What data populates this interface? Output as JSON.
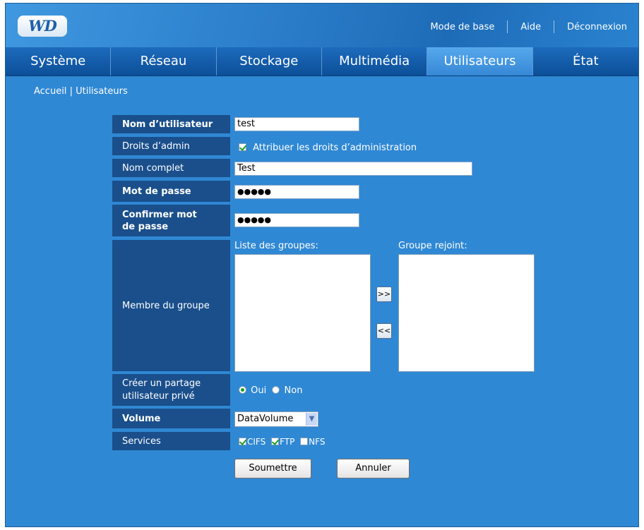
{
  "header": {
    "logo_text": "WD",
    "links": [
      "Mode de base",
      "Aide",
      "Déconnexion"
    ]
  },
  "nav": {
    "tabs": [
      "Système",
      "Réseau",
      "Stockage",
      "Multimédia",
      "Utilisateurs",
      "État"
    ],
    "active": "Utilisateurs"
  },
  "breadcrumb": {
    "home": "Accueil",
    "separator": "|",
    "current": "Utilisateurs"
  },
  "form": {
    "username_label": "Nom d’utilisateur",
    "username_value": "test",
    "admin_label": "Droits d’admin",
    "admin_checkbox_label": "Attribuer les droits d’administration",
    "admin_checked": true,
    "fullname_label": "Nom complet",
    "fullname_value": "Test",
    "password_label": "Mot de passe",
    "password_mask": "●●●●●",
    "confirm_label_line1": "Confirmer mot",
    "confirm_label_line2": "de passe",
    "confirm_mask": "●●●●●",
    "group_member_label": "Membre du groupe",
    "group_list_label": "Liste des groupes:",
    "joined_group_label": "Groupe rejoint:",
    "add_button": ">>",
    "remove_button": "<<",
    "private_share_label_line1": "Créer un partage",
    "private_share_label_line2": "utilisateur privé",
    "yes_label": "Oui",
    "no_label": "Non",
    "private_share_selected": "Oui",
    "volume_label": "Volume",
    "volume_value": "DataVolume",
    "services_label": "Services",
    "services": [
      {
        "name": "CIFS",
        "checked": true
      },
      {
        "name": "FTP",
        "checked": true
      },
      {
        "name": "NFS",
        "checked": false
      }
    ],
    "submit_label": "Soumettre",
    "cancel_label": "Annuler"
  },
  "colors": {
    "background": "#2f88d4",
    "label_bg": "#1a4f8c",
    "nav_bg": "#0c4f98",
    "active_tab": "#3688d6",
    "check_green": "#1e9a1e"
  }
}
